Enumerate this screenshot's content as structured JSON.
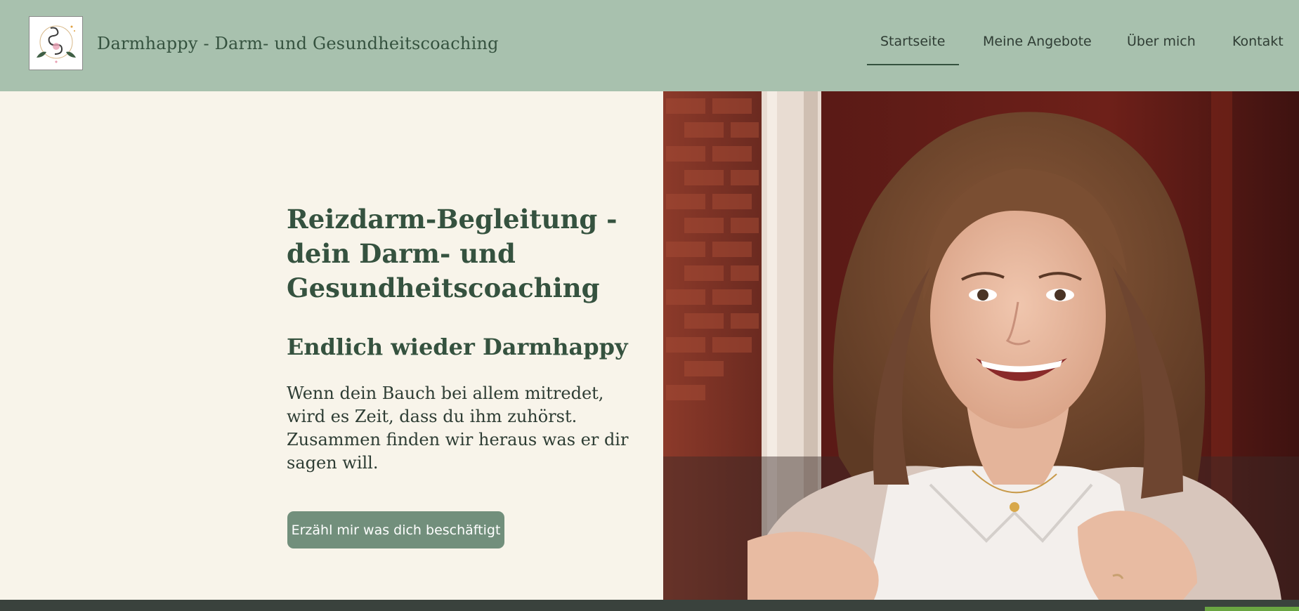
{
  "header": {
    "site_title": "Darmhappy - Darm- und Gesundheitscoaching",
    "logo_alt": "Darmhappy logo",
    "nav": {
      "home": "Startseite",
      "offers": "Meine Angebote",
      "about": "Über mich",
      "contact": "Kontakt"
    },
    "active_nav": "home"
  },
  "hero": {
    "heading": "Reizdarm-Begleitung - dein Darm- und Gesundheitscoaching",
    "subheading": "Endlich wieder Darmhappy",
    "text": "Wenn dein Bauch bei allem mitredet, wird es Zeit, dass du ihm zuhörst. Zusammen finden wir heraus was er dir sagen will.",
    "cta_label": "Erzähl mir was dich beschäftigt",
    "photo_alt": "Lächelnde Frau mit verschränkten Armen vor einer Backsteinwand"
  },
  "colors": {
    "header_bg": "#a8c1ae",
    "hero_bg": "#f8f4ea",
    "accent": "#35523f",
    "button_bg": "#728f7c",
    "footer_bg": "#3a423d",
    "footer_accent": "#6aa542"
  },
  "icons": {
    "logo": "gut-logo-icon"
  }
}
